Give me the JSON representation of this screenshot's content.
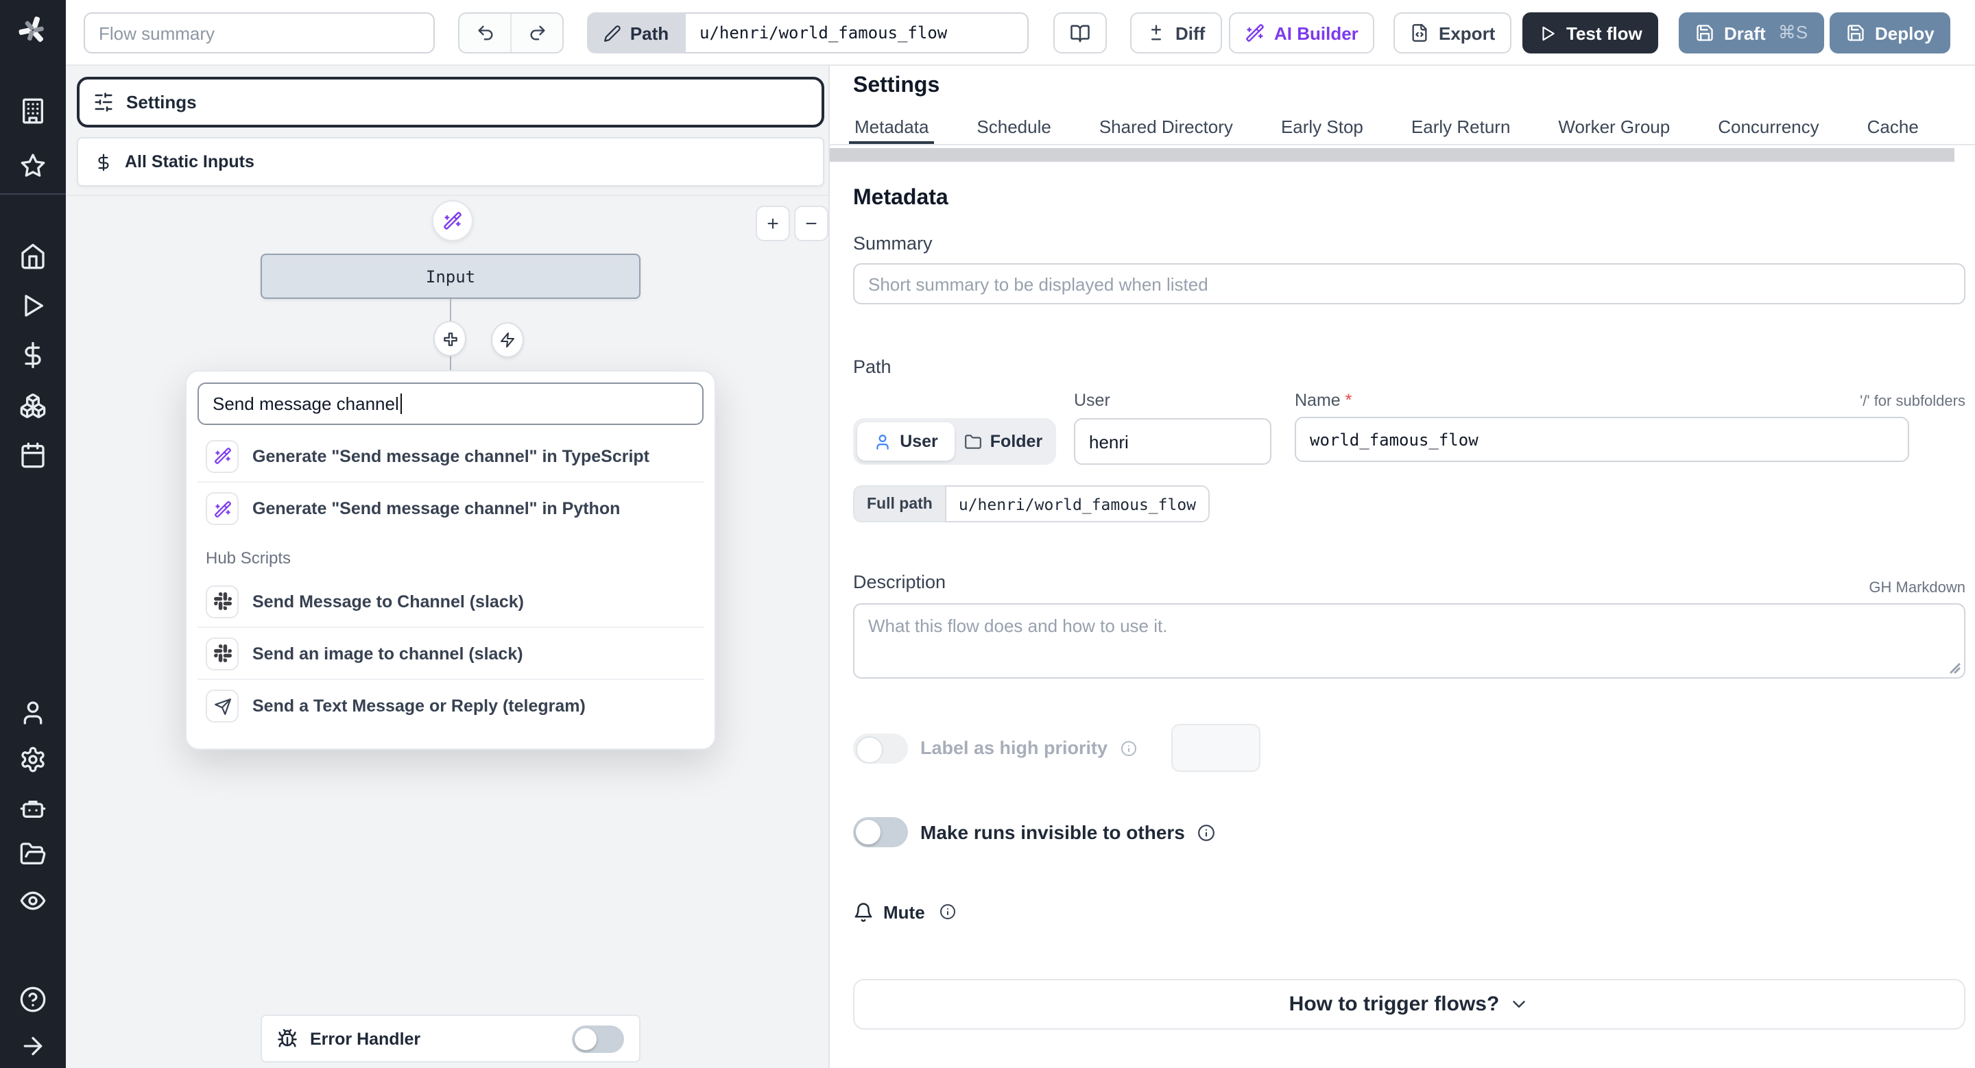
{
  "topbar": {
    "flow_summary_placeholder": "Flow summary",
    "path_badge": "Path",
    "path_value": "u/henri/world_famous_flow",
    "diff_label": "Diff",
    "ai_builder_label": "AI Builder",
    "export_label": "Export",
    "test_flow_label": "Test flow",
    "draft_label": "Draft",
    "draft_shortcut": "⌘S",
    "deploy_label": "Deploy"
  },
  "sidebar": {
    "icons": [
      "windmill-logo",
      "building",
      "star",
      "home",
      "play",
      "dollar",
      "boxes",
      "calendar",
      "user",
      "gear",
      "bot",
      "folder-open",
      "eye",
      "help",
      "arrow-right"
    ]
  },
  "flow_panel": {
    "settings_label": "Settings",
    "static_inputs_label": "All Static Inputs",
    "input_node_label": "Input",
    "search_value": "Send message channel",
    "zoom_in": "+",
    "zoom_out": "−",
    "generate_items": [
      {
        "icon": "wand",
        "label": "Generate \"Send message channel\" in TypeScript"
      },
      {
        "icon": "wand",
        "label": "Generate \"Send message channel\" in Python"
      }
    ],
    "hub_header": "Hub Scripts",
    "hub_items": [
      {
        "icon": "slack",
        "label": "Send Message to Channel (slack)"
      },
      {
        "icon": "slack",
        "label": "Send an image to channel (slack)"
      },
      {
        "icon": "telegram",
        "label": "Send a Text Message or Reply (telegram)"
      }
    ],
    "error_handler_label": "Error Handler"
  },
  "settings_panel": {
    "title": "Settings",
    "active_tab": "Metadata",
    "tabs": [
      "Metadata",
      "Schedule",
      "Shared Directory",
      "Early Stop",
      "Early Return",
      "Worker Group",
      "Concurrency",
      "Cache"
    ],
    "metadata": {
      "heading": "Metadata",
      "summary_label": "Summary",
      "summary_placeholder": "Short summary to be displayed when listed",
      "path_label": "Path",
      "owner_user": "User",
      "owner_folder": "Folder",
      "user_label": "User",
      "user_value": "henri",
      "name_label": "Name",
      "name_required": "*",
      "name_value": "world_famous_flow",
      "subfolder_hint": "'/' for subfolders",
      "full_path_label": "Full path",
      "full_path_value": "u/henri/world_famous_flow",
      "description_label": "Description",
      "description_hint": "GH Markdown",
      "description_placeholder": "What this flow does and how to use it.",
      "high_priority_label": "Label as high priority",
      "invisible_label": "Make runs invisible to others",
      "mute_label": "Mute",
      "trigger_label": "How to trigger flows?"
    }
  },
  "colors": {
    "sidebar_bg": "#1d212a",
    "accent_purple": "#7c3aed",
    "slate_button": "#6a87a6",
    "dark_button": "#272e3a",
    "node_bg": "#dbe1e9",
    "canvas_bg": "#f1f3f5",
    "active_tab_underline": "#2e3949"
  }
}
